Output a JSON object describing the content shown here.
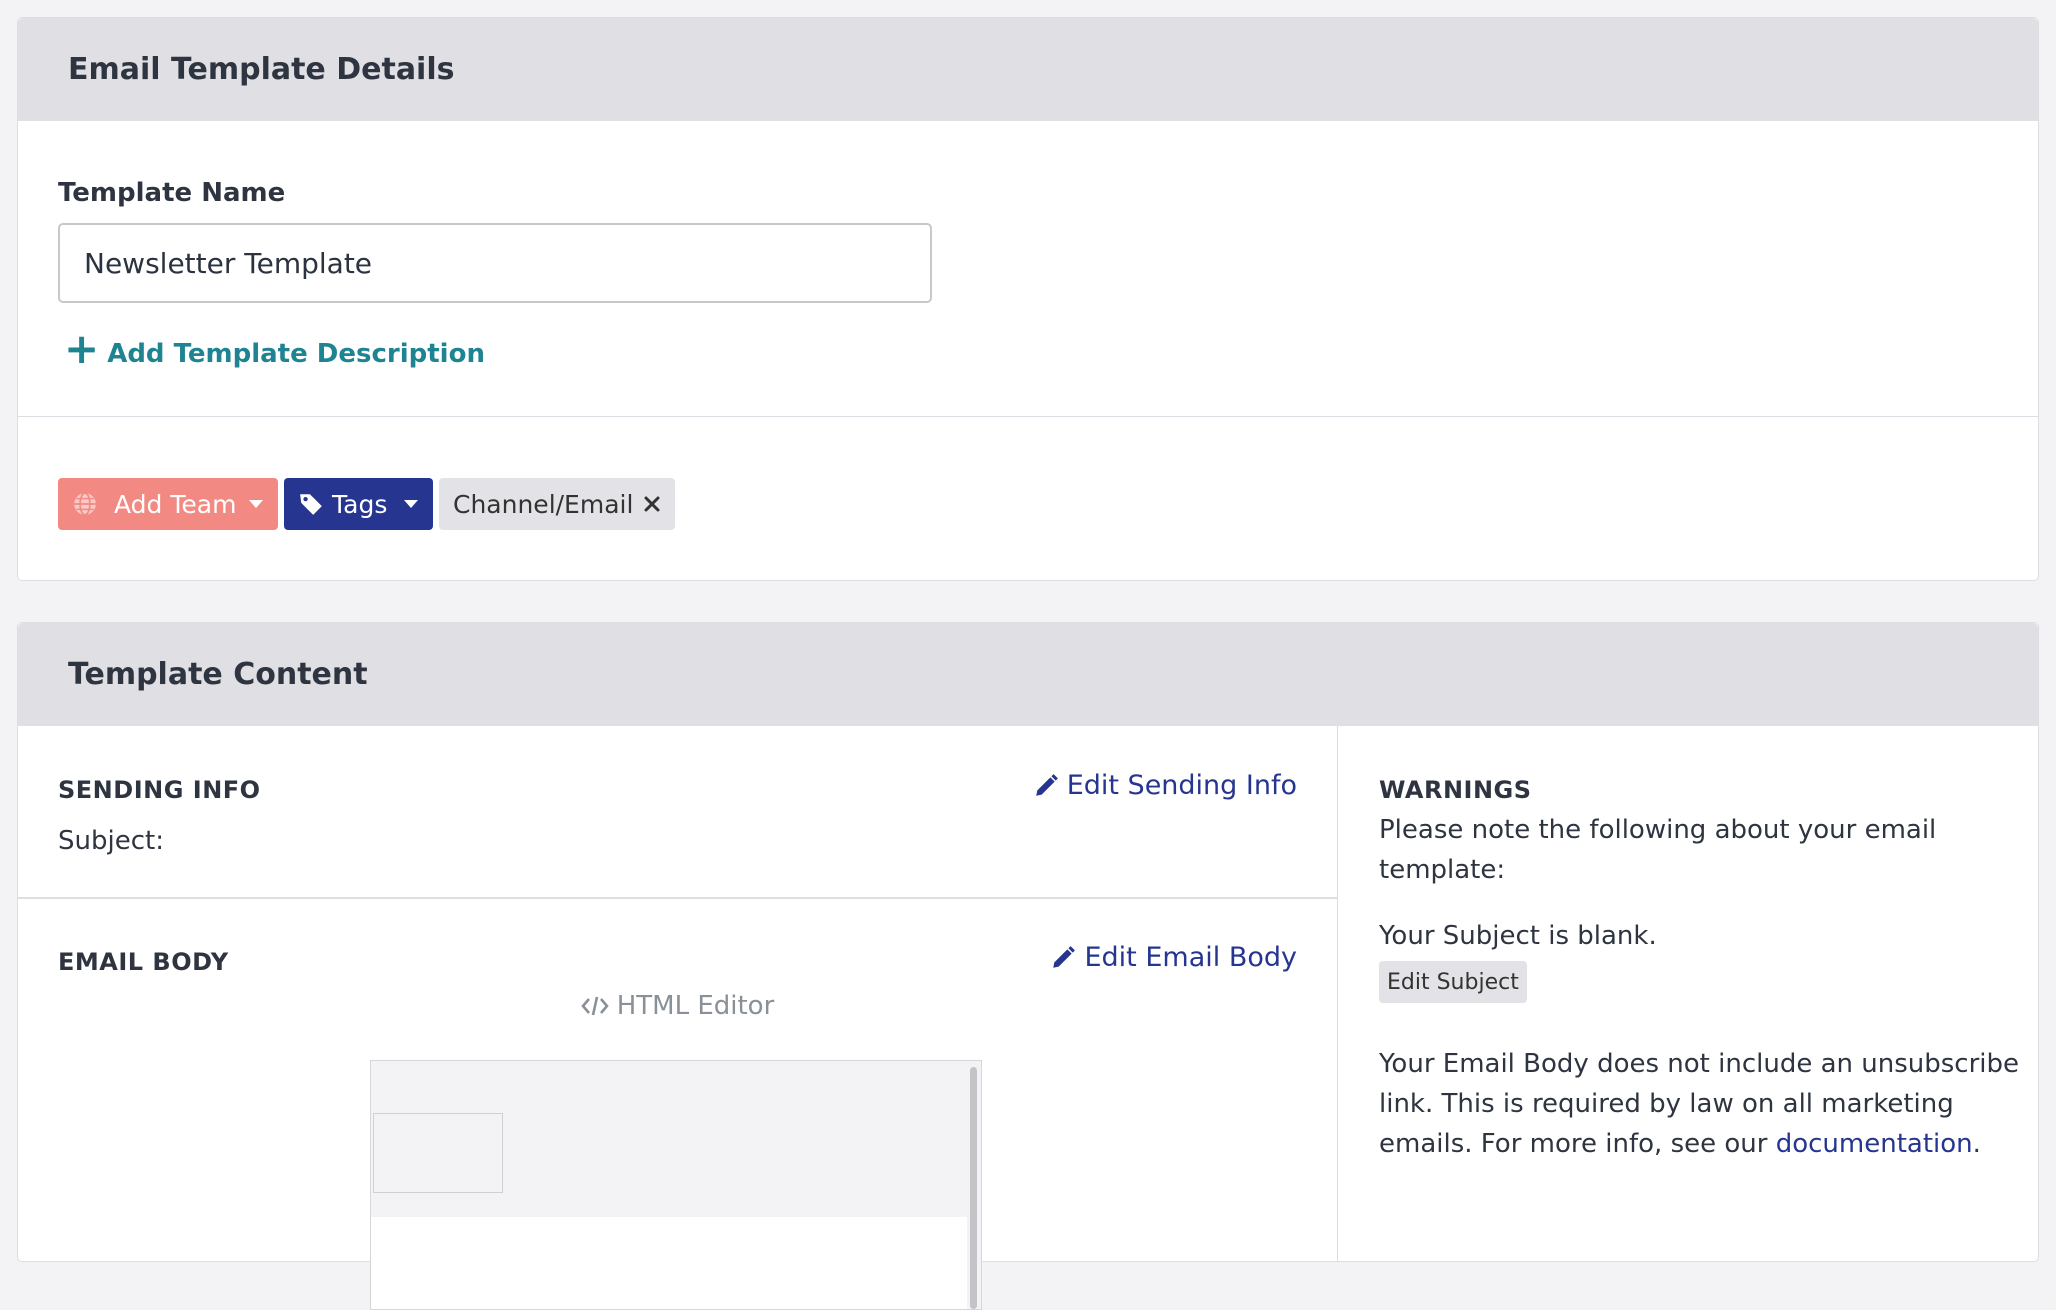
{
  "details": {
    "header": "Email Template Details",
    "name_label": "Template Name",
    "name_value": "Newsletter Template",
    "add_description": "Add Template Description"
  },
  "tags": {
    "add_team": "Add Team",
    "tags_label": "Tags",
    "channel_tag": "Channel/Email"
  },
  "content": {
    "header": "Template Content",
    "sending_info_title": "SENDING INFO",
    "edit_sending_info": "Edit Sending Info",
    "subject_label": "Subject:",
    "email_body_title": "EMAIL BODY",
    "edit_email_body": "Edit Email Body",
    "html_editor": "HTML Editor"
  },
  "warnings": {
    "title": "WARNINGS",
    "intro": "Please note the following about your email template:",
    "subject_blank": "Your Subject is blank.",
    "edit_subject": "Edit Subject",
    "unsubscribe_text": "Your Email Body does not include an unsubscribe link. This is required by law on all marketing emails. For more info, see our",
    "documentation_link": "documentation",
    "period": "."
  },
  "colors": {
    "teal": "#1f8491",
    "navy": "#26358f",
    "salmon": "#f28a83",
    "header_bg": "#dfdfe4"
  },
  "icons": [
    "plus-icon",
    "globe-icon",
    "caret-down-icon",
    "tag-icon",
    "close-icon",
    "pencil-icon",
    "code-icon"
  ]
}
